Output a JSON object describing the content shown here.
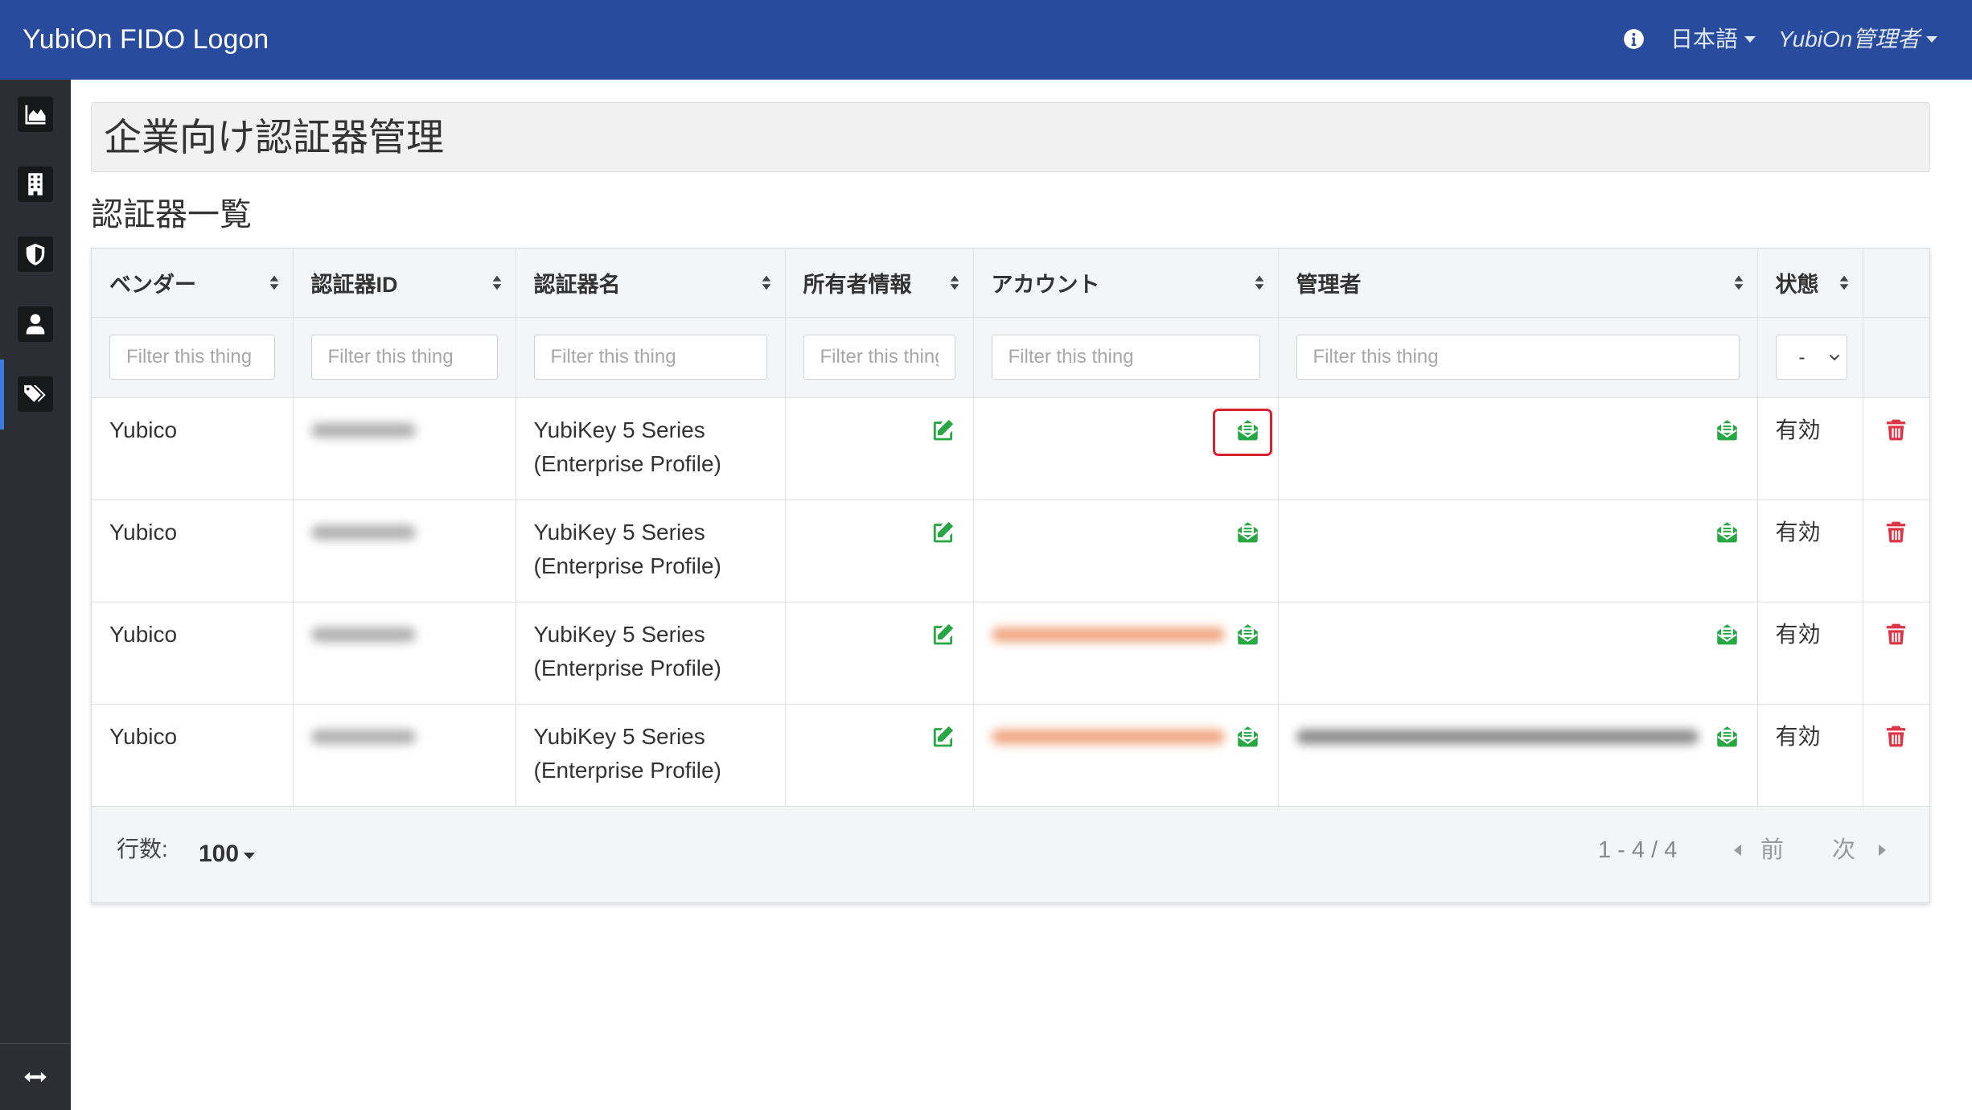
{
  "app": {
    "title": "YubiOn FIDO Logon"
  },
  "navbar": {
    "info_icon": "info-circle-icon",
    "language": "日本語",
    "user": "YubiOn管理者"
  },
  "sidebar": {
    "items": [
      {
        "icon": "chart-area-icon",
        "active": false
      },
      {
        "icon": "building-icon",
        "active": false
      },
      {
        "icon": "shield-icon",
        "active": false
      },
      {
        "icon": "user-icon",
        "active": false
      },
      {
        "icon": "tags-icon",
        "active": true
      }
    ],
    "toggle_icon": "arrows-horizontal-icon"
  },
  "page": {
    "title": "企業向け認証器管理",
    "section_title": "認証器一覧"
  },
  "table": {
    "columns": [
      "ベンダー",
      "認証器ID",
      "認証器名",
      "所有者情報",
      "アカウント",
      "管理者",
      "状態",
      ""
    ],
    "filter_placeholder": "Filter this thing",
    "status_filter_value": "-",
    "row_icons": {
      "owner": "edit-icon",
      "account": "envelope-open-text-icon",
      "admin": "envelope-open-text-icon",
      "delete": "trash-icon"
    },
    "rows": [
      {
        "vendor": "Yubico",
        "name": "YubiKey 5 Series (Enterprise Profile)",
        "status": "有効",
        "authenticator_id_redacted": true,
        "account_redacted": false,
        "admin_redacted": false,
        "account_icon_highlighted": true
      },
      {
        "vendor": "Yubico",
        "name": "YubiKey 5 Series (Enterprise Profile)",
        "status": "有効",
        "authenticator_id_redacted": true,
        "account_redacted": false,
        "admin_redacted": false,
        "account_icon_highlighted": false
      },
      {
        "vendor": "Yubico",
        "name": "YubiKey 5 Series (Enterprise Profile)",
        "status": "有効",
        "authenticator_id_redacted": true,
        "account_redacted": true,
        "admin_redacted": false,
        "account_icon_highlighted": false
      },
      {
        "vendor": "Yubico",
        "name": "YubiKey 5 Series (Enterprise Profile)",
        "status": "有効",
        "authenticator_id_redacted": true,
        "account_redacted": true,
        "admin_redacted": true,
        "account_icon_highlighted": false
      }
    ]
  },
  "footer": {
    "rows_label": "行数:",
    "rows_per_page": "100",
    "range": "1 - 4 / 4",
    "prev": "前",
    "next": "次"
  },
  "colors": {
    "navbar": "#284b9d",
    "sidebar": "#2b2e33",
    "action_green": "#28a745",
    "delete_red": "#dc3545",
    "highlight_red": "#d8232f"
  }
}
